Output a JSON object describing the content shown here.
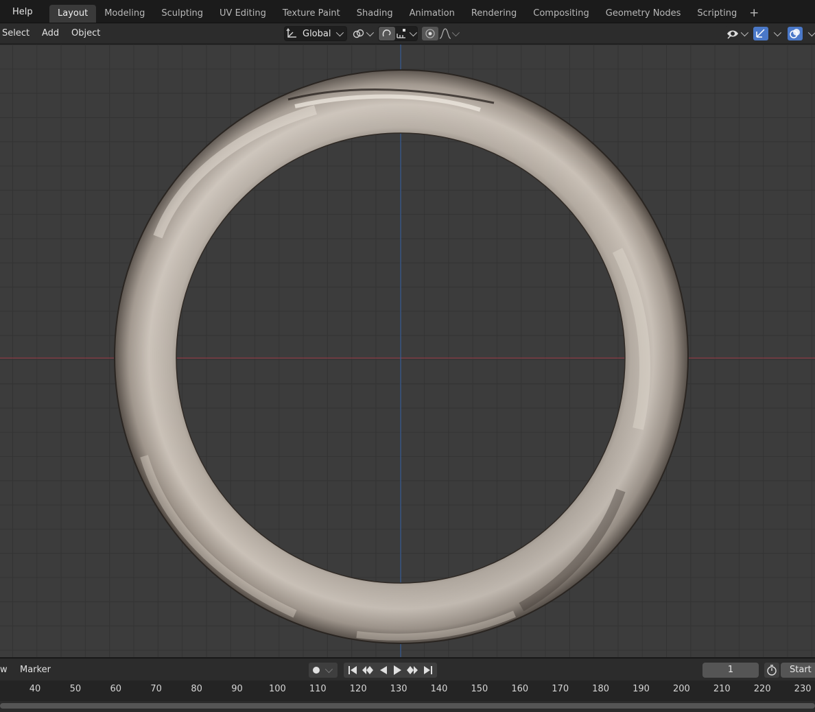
{
  "topbar": {
    "help": "Help",
    "tabs": [
      "Layout",
      "Modeling",
      "Sculpting",
      "UV Editing",
      "Texture Paint",
      "Shading",
      "Animation",
      "Rendering",
      "Compositing",
      "Geometry Nodes",
      "Scripting"
    ],
    "active_tab": "Layout",
    "add_tab_icon": "plus-icon"
  },
  "viewport_header": {
    "select": "Select",
    "add": "Add",
    "object": "Object",
    "transform_orientation": "Global",
    "icons": [
      "transform-orientation-icon",
      "pivot-point-icon",
      "snap-icon",
      "snap-target-icon",
      "proportional-edit-icon",
      "falloff-icon",
      "visibility-icon",
      "gizmo-icon",
      "overlay-icon"
    ],
    "accent_color": "#4a78c8"
  },
  "viewport": {
    "background": "#3c3c3c",
    "x_axis_color": "#8a3b44",
    "y_axis_color": "#3a5f9a",
    "object": "ring"
  },
  "timeline_header": {
    "view_partial": "w",
    "marker": "Marker",
    "current_frame": "1",
    "start_label": "Start",
    "icons": [
      "record-icon",
      "jump-start-icon",
      "prev-keyframe-icon",
      "play-reverse-icon",
      "play-icon",
      "next-keyframe-icon",
      "jump-end-icon",
      "stopwatch-icon"
    ]
  },
  "ruler": {
    "ticks": [
      "40",
      "50",
      "60",
      "70",
      "80",
      "90",
      "100",
      "110",
      "120",
      "130",
      "140",
      "150",
      "160",
      "170",
      "180",
      "190",
      "200",
      "210",
      "220",
      "230"
    ]
  }
}
